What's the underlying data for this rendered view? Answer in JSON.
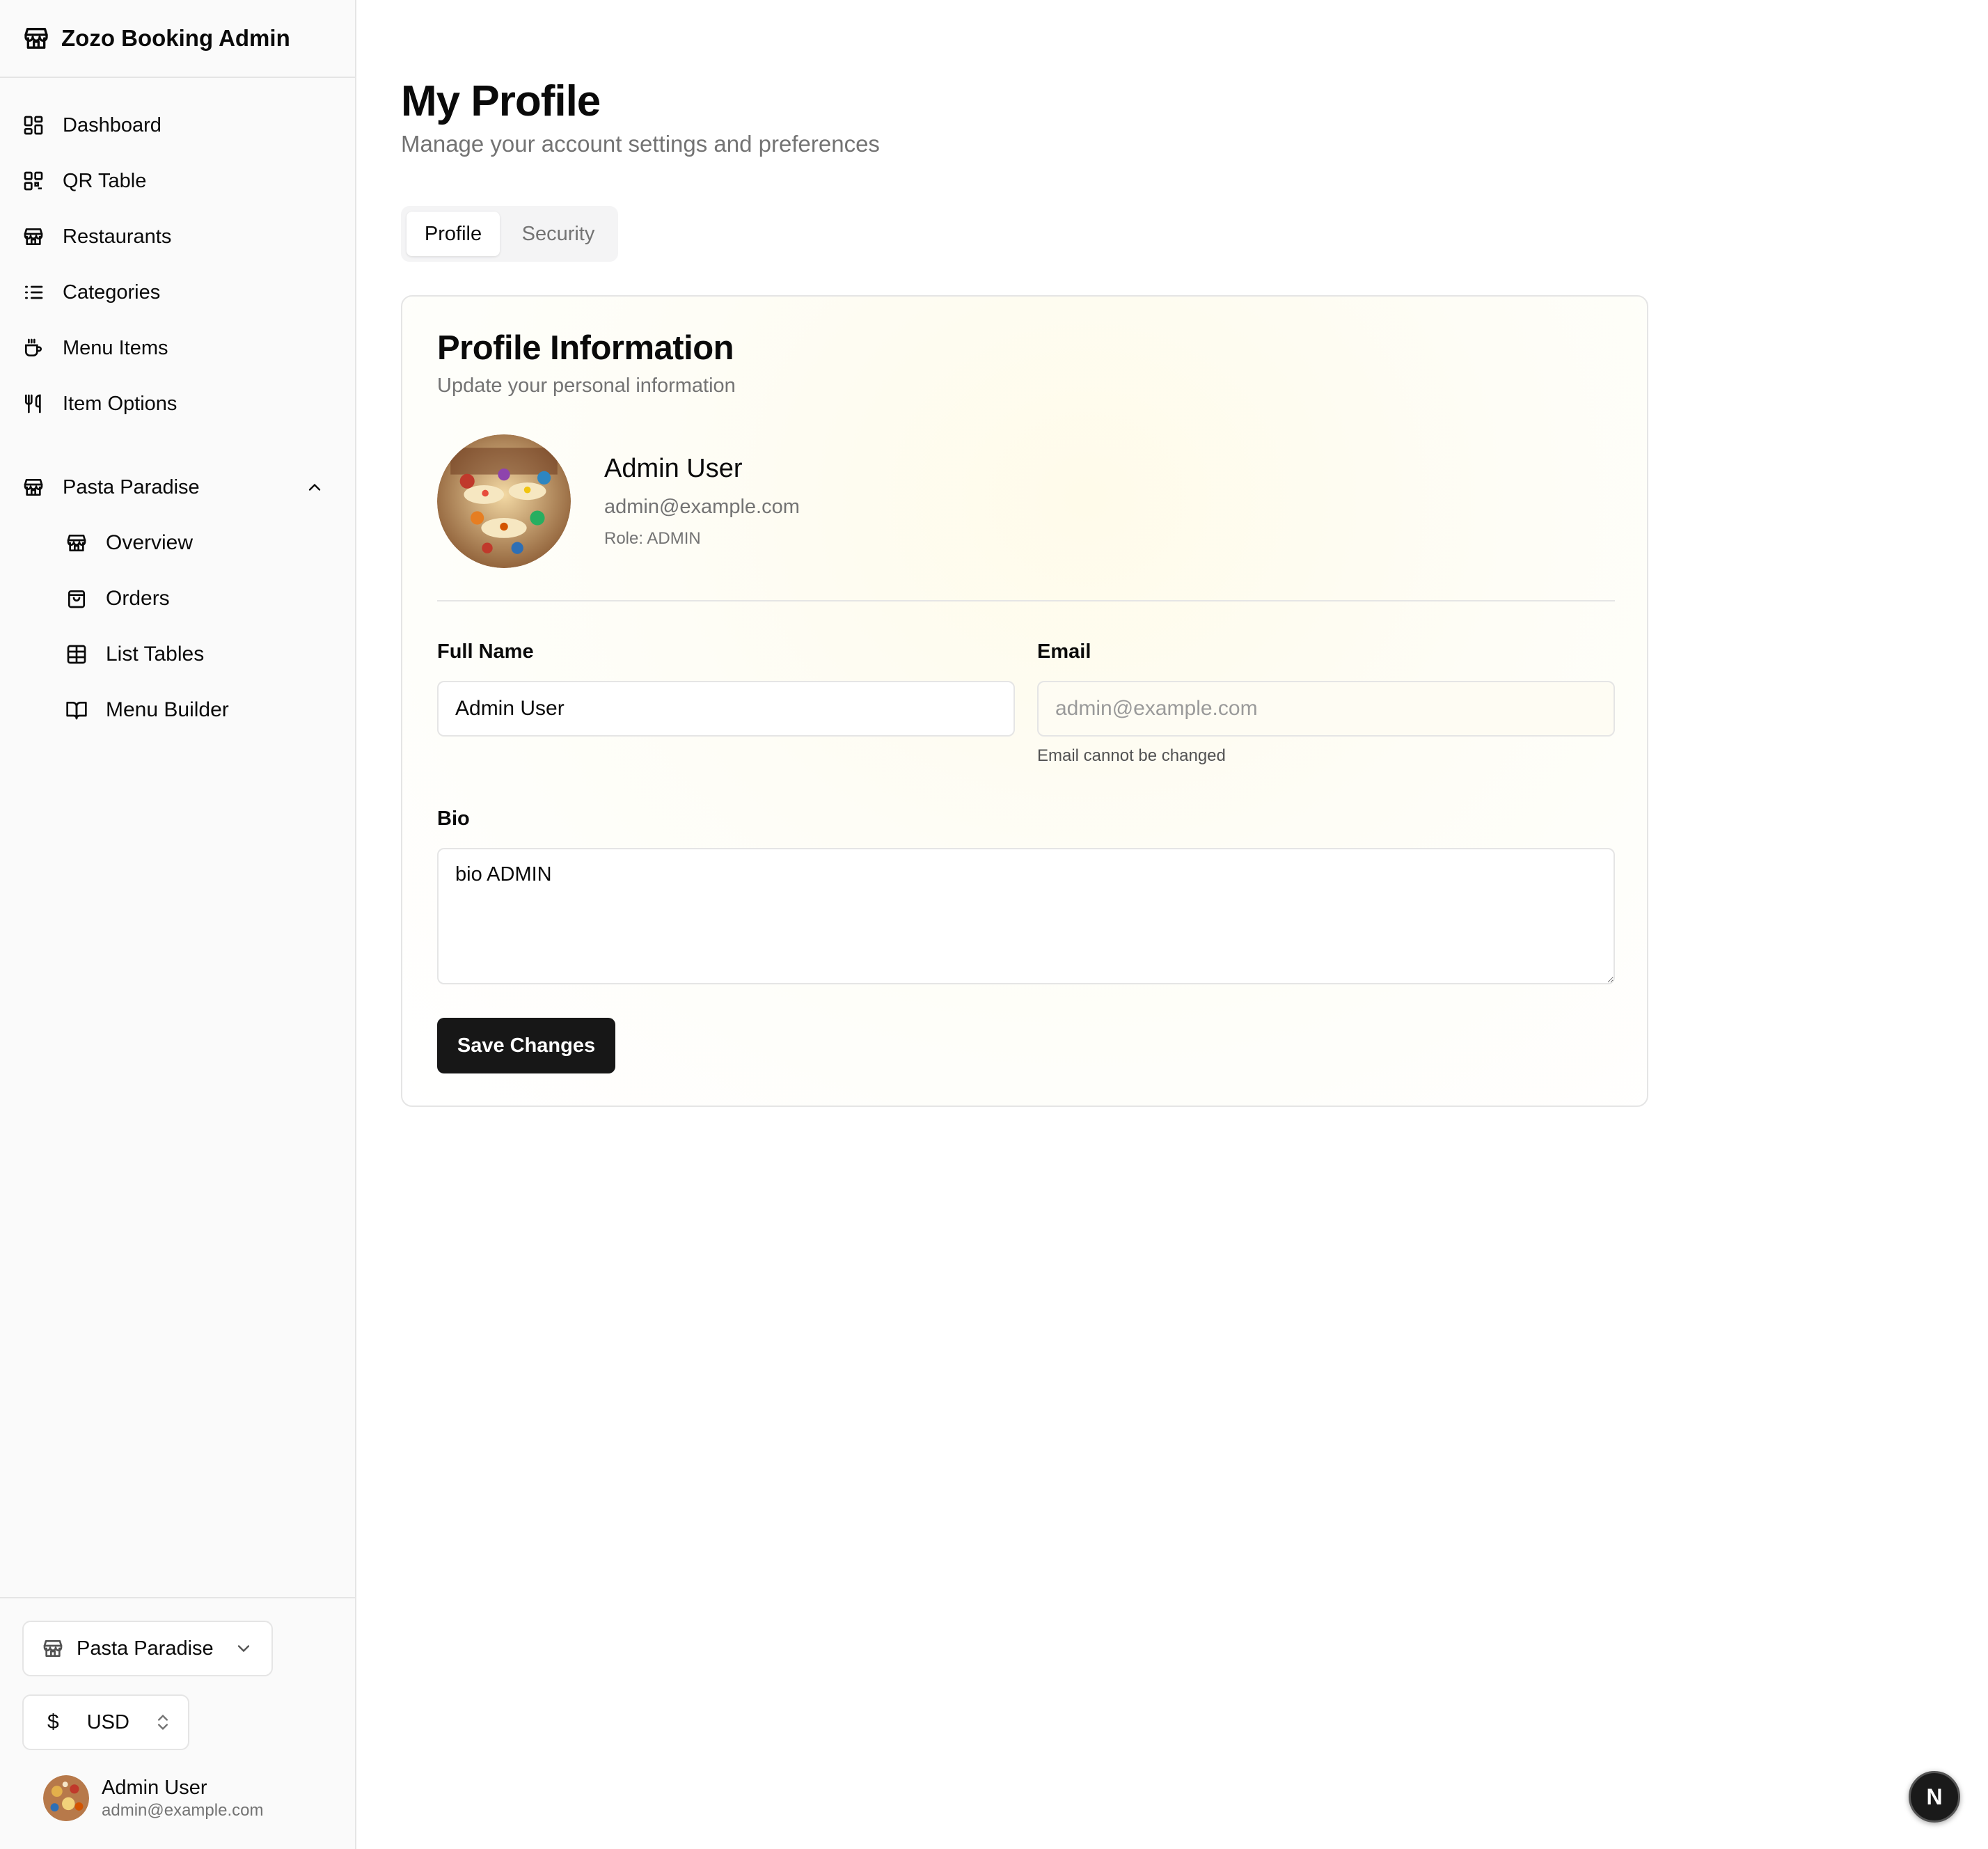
{
  "app": {
    "title": "Zozo Booking Admin"
  },
  "sidebar": {
    "nav": [
      {
        "label": "Dashboard",
        "icon": "dashboard-icon"
      },
      {
        "label": "QR Table",
        "icon": "qr-code-icon"
      },
      {
        "label": "Restaurants",
        "icon": "store-icon"
      },
      {
        "label": "Categories",
        "icon": "list-icon"
      },
      {
        "label": "Menu Items",
        "icon": "coffee-icon"
      },
      {
        "label": "Item Options",
        "icon": "utensils-icon"
      }
    ],
    "group": {
      "label": "Pasta Paradise",
      "icon": "store-icon",
      "expanded": true,
      "items": [
        {
          "label": "Overview",
          "icon": "store-icon"
        },
        {
          "label": "Orders",
          "icon": "shopping-bag-icon"
        },
        {
          "label": "List Tables",
          "icon": "table-icon"
        },
        {
          "label": "Menu Builder",
          "icon": "book-open-icon"
        }
      ]
    },
    "footer": {
      "restaurant_select": "Pasta Paradise",
      "currency_symbol": "$",
      "currency_select": "USD",
      "user": {
        "name": "Admin User",
        "email": "admin@example.com"
      }
    }
  },
  "main": {
    "title": "My Profile",
    "subtitle": "Manage your account settings and preferences",
    "tabs": [
      {
        "label": "Profile",
        "active": true
      },
      {
        "label": "Security",
        "active": false
      }
    ],
    "card": {
      "title": "Profile Information",
      "subtitle": "Update your personal information",
      "profile": {
        "name": "Admin User",
        "email": "admin@example.com",
        "role": "Role: ADMIN"
      },
      "full_name_label": "Full Name",
      "full_name_value": "Admin User",
      "email_label": "Email",
      "email_placeholder": "admin@example.com",
      "email_hint": "Email cannot be changed",
      "bio_label": "Bio",
      "bio_value": "bio ADMIN",
      "save_label": "Save Changes"
    }
  },
  "fab": {
    "label": "N"
  },
  "colors": {
    "primary": "#171717",
    "muted": "#737373",
    "border": "#e5e5e5",
    "card_tint": "#fffbea"
  }
}
